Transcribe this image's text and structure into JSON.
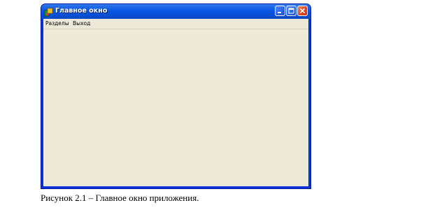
{
  "window": {
    "title": "Главное окно",
    "icon": "app-icon"
  },
  "menu": {
    "items": [
      {
        "label": "Разделы"
      },
      {
        "label": "Выход"
      }
    ]
  },
  "caption": "Рисунок 2.1 – Главное окно приложения.",
  "colors": {
    "titlebar": "#0a56e0",
    "window_border": "#0831d9",
    "client_bg": "#ece9d8",
    "close_button": "#db4a22"
  }
}
